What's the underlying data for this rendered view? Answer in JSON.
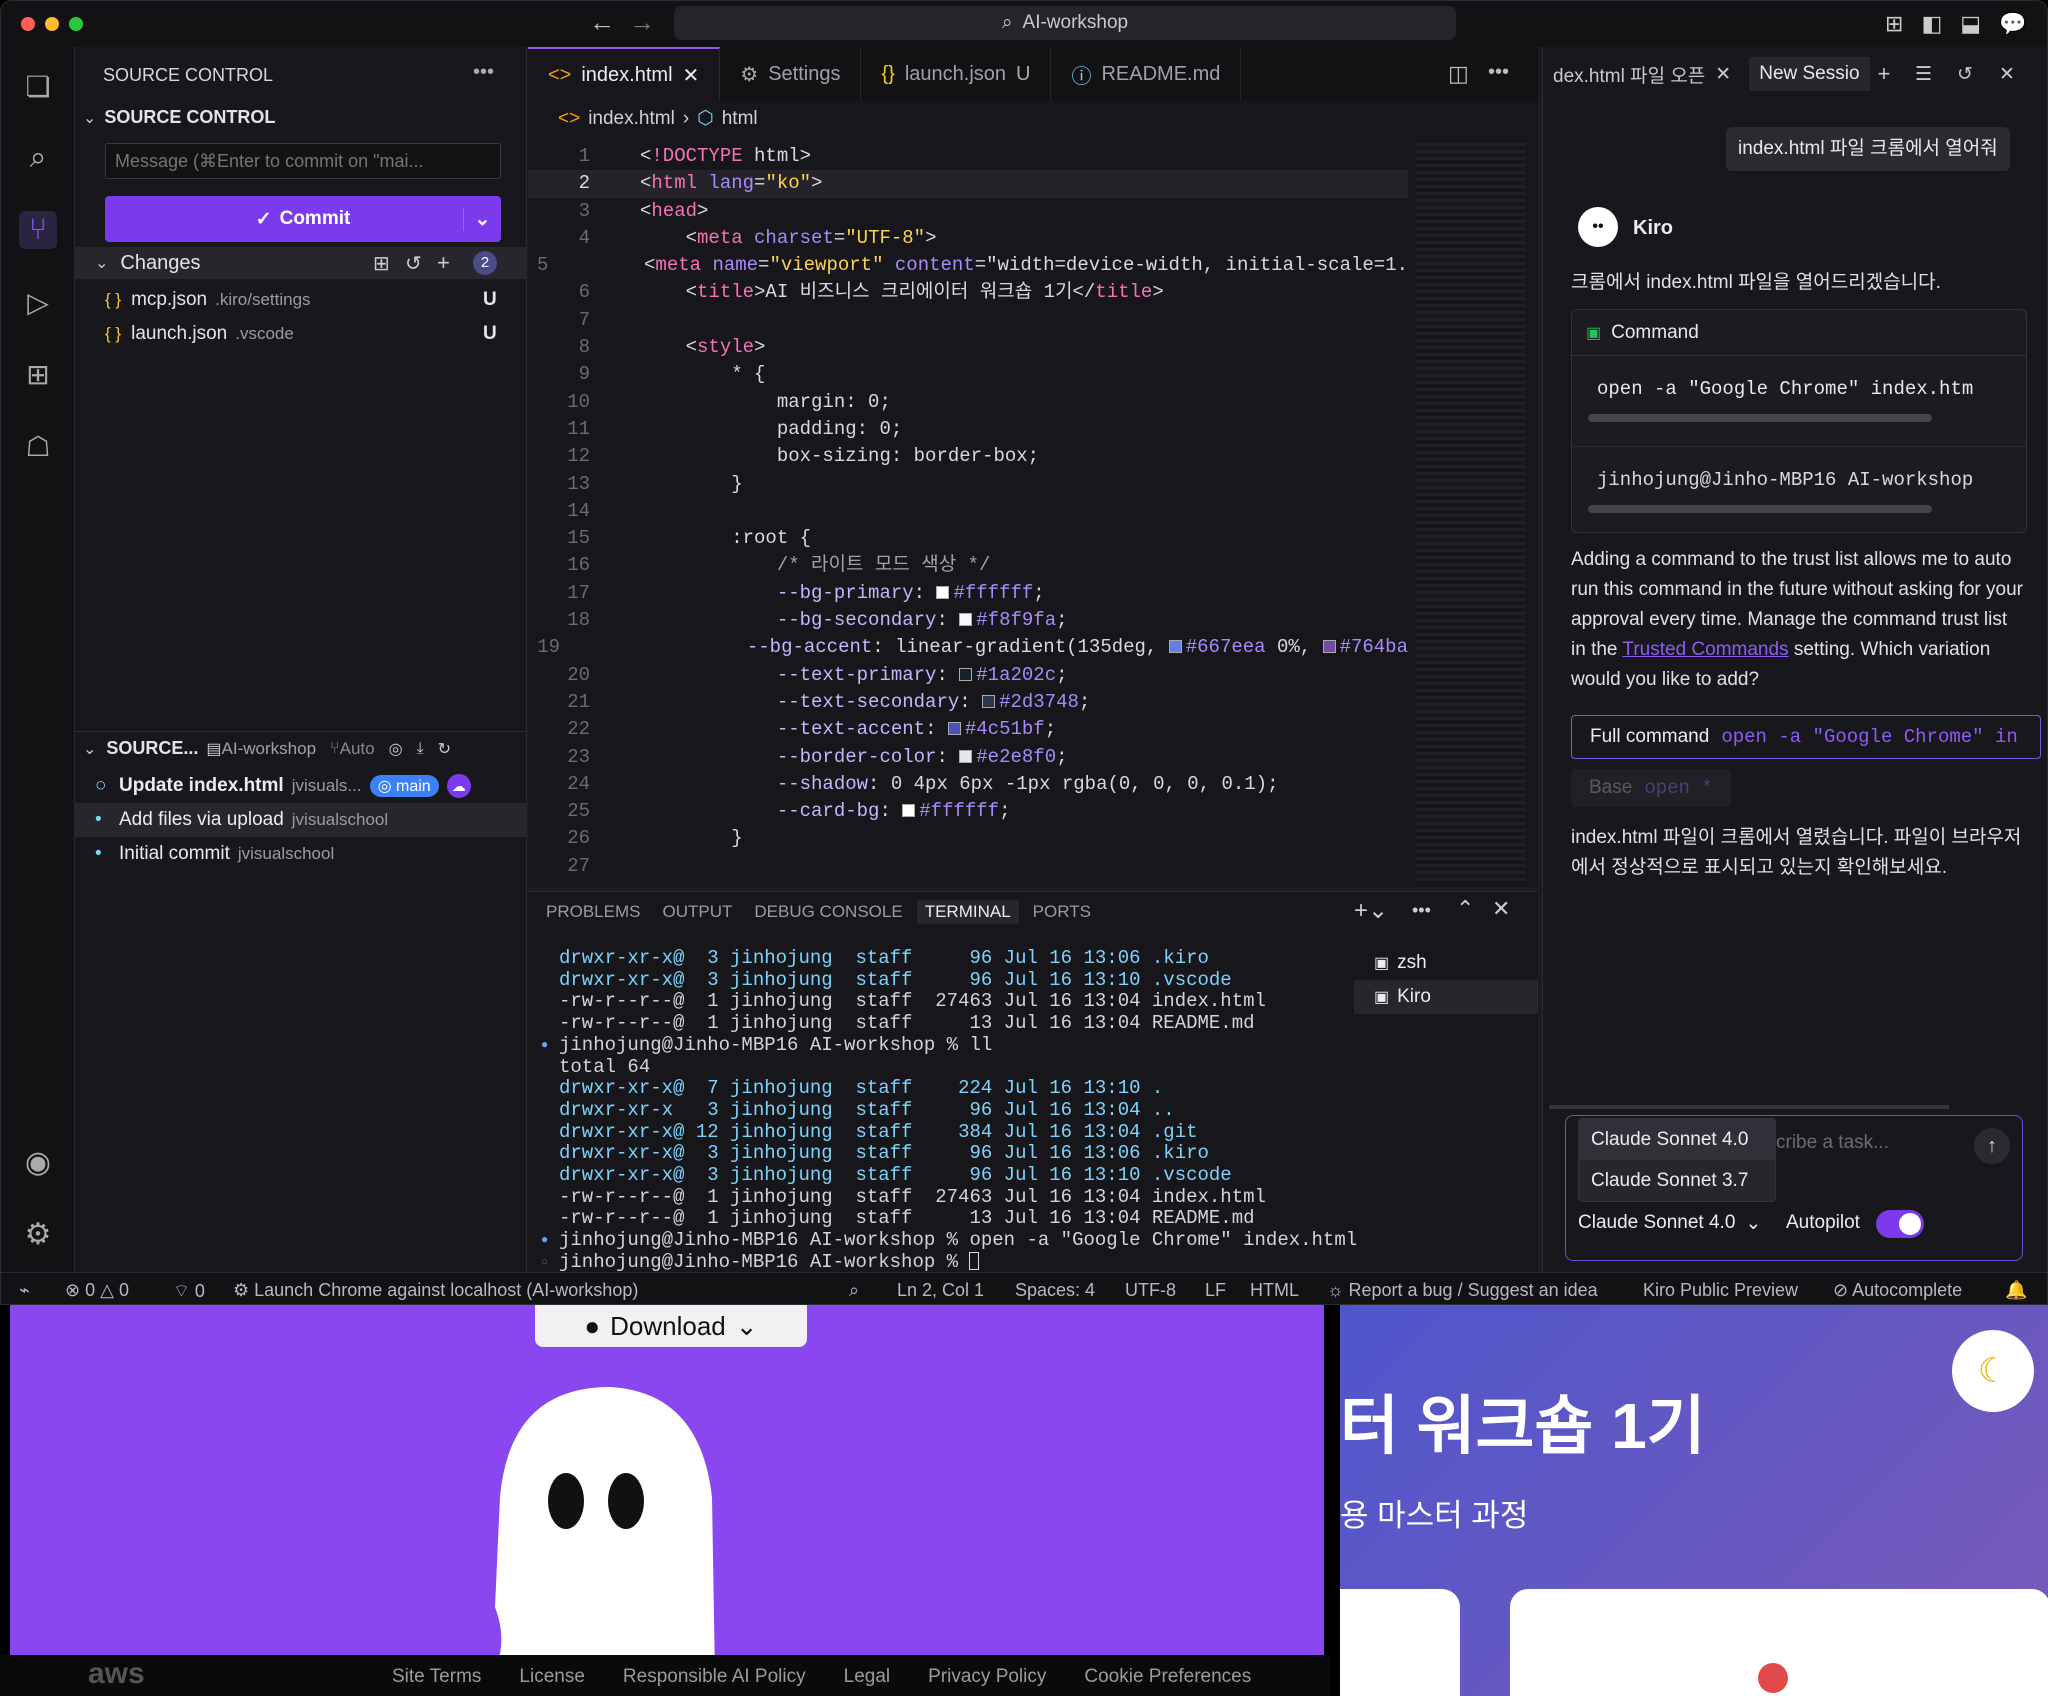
{
  "window": {
    "search_text": "AI-workshop"
  },
  "sidebar": {
    "title": "SOURCE CONTROL",
    "section": "SOURCE CONTROL",
    "message_placeholder": "Message (⌘Enter to commit on \"mai...",
    "commit_label": "Commit",
    "changes_label": "Changes",
    "changes_count": "2",
    "files": [
      {
        "name": "mcp.json",
        "path": ".kiro/settings",
        "status": "U"
      },
      {
        "name": "launch.json",
        "path": ".vscode",
        "status": "U"
      }
    ],
    "graph_title": "SOURCE...",
    "graph_repo": "AI-workshop",
    "graph_auto": "Auto",
    "commits": [
      {
        "msg": "Update index.html",
        "author": "jvisuals...",
        "badge": "main"
      },
      {
        "msg": "Add files via upload",
        "author": "jvisualschool"
      },
      {
        "msg": "Initial commit",
        "author": "jvisualschool"
      }
    ]
  },
  "editor": {
    "tabs": [
      {
        "label": "index.html",
        "suffix": ""
      },
      {
        "label": "Settings",
        "suffix": ""
      },
      {
        "label": "launch.json",
        "suffix": "U"
      },
      {
        "label": "README.md",
        "suffix": ""
      }
    ],
    "breadcrumb": {
      "file": "index.html",
      "node": "html"
    },
    "lines": [
      "<!DOCTYPE html>",
      "<html lang=\"ko\">",
      "<head>",
      "    <meta charset=\"UTF-8\">",
      "    <meta name=\"viewport\" content=\"width=device-width, initial-scale=1.",
      "    <title>AI 비즈니스 크리에이터 워크숍 1기</title>",
      "",
      "    <style>",
      "        * {",
      "            margin: 0;",
      "            padding: 0;",
      "            box-sizing: border-box;",
      "        }",
      "",
      "        :root {",
      "            /* 라이트 모드 색상 */",
      "            --bg-primary: #ffffff;",
      "            --bg-secondary: #f8f9fa;",
      "            --bg-accent: linear-gradient(135deg, #667eea 0%, #764ba",
      "            --text-primary: #1a202c;",
      "            --text-secondary: #2d3748;",
      "            --text-accent: #4c51bf;",
      "            --border-color: #e2e8f0;",
      "            --shadow: 0 4px 6px -1px rgba(0, 0, 0, 0.1);",
      "            --card-bg: #ffffff;",
      "        }",
      ""
    ]
  },
  "panel": {
    "tabs": [
      "PROBLEMS",
      "OUTPUT",
      "DEBUG CONSOLE",
      "TERMINAL",
      "PORTS"
    ],
    "terminal_lines": [
      "drwxr-xr-x@  3 jinhojung  staff     96 Jul 16 13:06 .kiro",
      "drwxr-xr-x@  3 jinhojung  staff     96 Jul 16 13:10 .vscode",
      "-rw-r--r--@  1 jinhojung  staff  27463 Jul 16 13:04 index.html",
      "-rw-r--r--@  1 jinhojung  staff     13 Jul 16 13:04 README.md",
      "jinhojung@Jinho-MBP16 AI-workshop % ll",
      "total 64",
      "drwxr-xr-x@  7 jinhojung  staff    224 Jul 16 13:10 .",
      "drwxr-xr-x   3 jinhojung  staff     96 Jul 16 13:04 ..",
      "drwxr-xr-x@ 12 jinhojung  staff    384 Jul 16 13:04 .git",
      "drwxr-xr-x@  3 jinhojung  staff     96 Jul 16 13:06 .kiro",
      "drwxr-xr-x@  3 jinhojung  staff     96 Jul 16 13:10 .vscode",
      "-rw-r--r--@  1 jinhojung  staff  27463 Jul 16 13:04 index.html",
      "-rw-r--r--@  1 jinhojung  staff     13 Jul 16 13:04 README.md",
      "jinhojung@Jinho-MBP16 AI-workshop % open -a \"Google Chrome\" index.html",
      "jinhojung@Jinho-MBP16 AI-workshop % "
    ],
    "terminals": [
      "zsh",
      "Kiro"
    ]
  },
  "chat": {
    "tabs": [
      "dex.html 파일 오픈",
      "New Sessio"
    ],
    "user_msg": "index.html 파일 크롬에서 열어줘",
    "assistant_name": "Kiro",
    "reply1": "크롬에서 index.html 파일을 열어드리겠습니다.",
    "command_title": "Command",
    "command": "open -a \"Google Chrome\" index.htm",
    "command_output": "jinhojung@Jinho-MBP16 AI-workshop",
    "trust_text": "Adding a command to the trust list allows me to auto run this command in the future without asking for your approval every time. Manage the command trust list in the",
    "trust_link": "Trusted Commands",
    "trust_tail": "setting. Which variation would you like to add?",
    "full_label": "Full command",
    "full_cmd": "open -a \"Google Chrome\" in",
    "base_label": "Base",
    "base_cmd": "open *",
    "reply2": "index.html 파일이 크롬에서 열렸습니다. 파일이 브라우저에서 정상적으로 표시되고 있는지 확인해보세요.",
    "input_placeholder": "cribe a task...",
    "model_options": [
      "Claude Sonnet 4.0",
      "Claude Sonnet 3.7"
    ],
    "model_selected": "Claude Sonnet 4.0",
    "autopilot_label": "Autopilot"
  },
  "status": {
    "errors": "0",
    "warnings": "0",
    "ports": "0",
    "launch": "Launch Chrome against localhost (AI-workshop)",
    "position": "Ln 2, Col 1",
    "spaces": "Spaces: 4",
    "encoding": "UTF-8",
    "eol": "LF",
    "lang": "HTML",
    "report": "Report a bug / Suggest an idea",
    "preview": "Kiro Public Preview",
    "autocomplete": "Autocomplete"
  },
  "background": {
    "download": "Download",
    "footer_links": [
      "Site Terms",
      "License",
      "Responsible AI Policy",
      "Legal",
      "Privacy Policy",
      "Cookie Preferences"
    ],
    "aws": "aws",
    "heading": "터 워크숍 1기",
    "subheading": "용 마스터 과정"
  }
}
